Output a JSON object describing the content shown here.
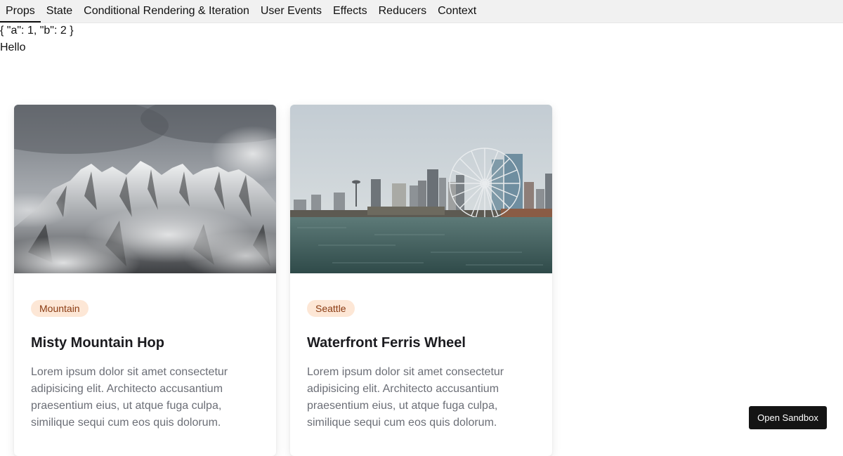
{
  "tabs": [
    {
      "label": "Props",
      "active": true
    },
    {
      "label": "State",
      "active": false
    },
    {
      "label": "Conditional Rendering & Iteration",
      "active": false
    },
    {
      "label": "User Events",
      "active": false
    },
    {
      "label": "Effects",
      "active": false
    },
    {
      "label": "Reducers",
      "active": false
    },
    {
      "label": "Context",
      "active": false
    }
  ],
  "output": {
    "json_line": "{ \"a\": 1, \"b\": 2 }",
    "greeting": "Hello"
  },
  "cards": [
    {
      "tag": "Mountain",
      "title": "Misty Mountain Hop",
      "text": "Lorem ipsum dolor sit amet consectetur adipisicing elit. Architecto accusantium praesentium eius, ut atque fuga culpa, similique sequi cum eos quis dolorum.",
      "image": "snowy-mountain-photo"
    },
    {
      "tag": "Seattle",
      "title": "Waterfront Ferris Wheel",
      "text": "Lorem ipsum dolor sit amet consectetur adipisicing elit. Architecto accusantium praesentium eius, ut atque fuga culpa, similique sequi cum eos quis dolorum.",
      "image": "seattle-waterfront-photo"
    }
  ],
  "sandbox": {
    "label": "Open Sandbox"
  },
  "colors": {
    "tag_bg": "#fde7d6",
    "tag_text": "#8a3b12",
    "button_bg": "#141414"
  }
}
